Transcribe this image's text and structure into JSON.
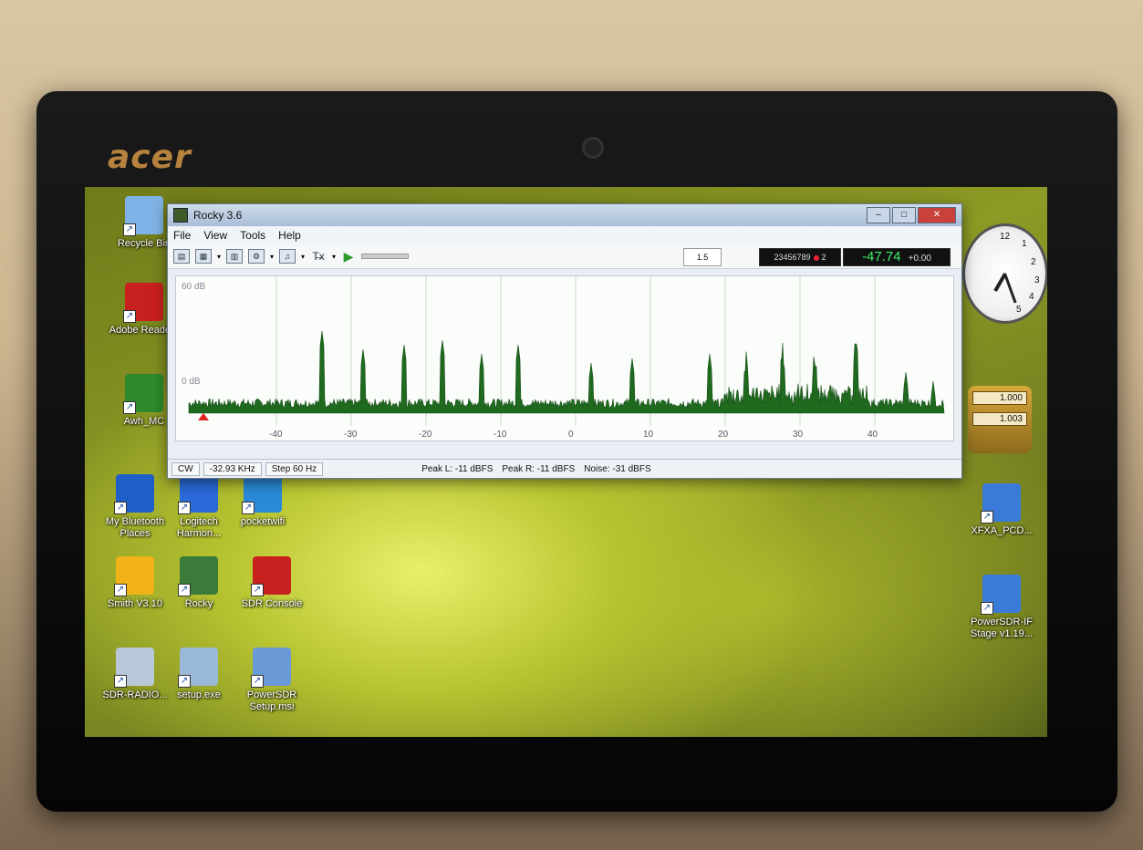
{
  "laptop": {
    "brand": "acer"
  },
  "desktop_icons": [
    {
      "id": "recycle-bin",
      "label": "Recycle Bin",
      "icon": "recycle-bin-icon",
      "color": "#7fb2e6"
    },
    {
      "id": "adobe-reader",
      "label": "Adobe Reade 9",
      "icon": "adobe-reader-icon",
      "color": "#c8201e"
    },
    {
      "id": "awh-mc",
      "label": "Awh_MC",
      "icon": "audio-meter-icon",
      "color": "#2c8a2c"
    },
    {
      "id": "my-bluetooth",
      "label": "My Bluetooth Places",
      "icon": "bluetooth-icon",
      "color": "#1f5fc7"
    },
    {
      "id": "logitech-harmony",
      "label": "Logitech Harmon...",
      "icon": "harmony-icon",
      "color": "#2a6ad8"
    },
    {
      "id": "pocketwifi",
      "label": "pocketwifi",
      "icon": "pocketwifi-icon",
      "color": "#2a8ad8"
    },
    {
      "id": "smith",
      "label": "Smith V3.10",
      "icon": "smith-chart-icon",
      "color": "#f2b21a"
    },
    {
      "id": "rocky",
      "label": "Rocky",
      "icon": "circuit-board-icon",
      "color": "#3a7a3a"
    },
    {
      "id": "sdr-console",
      "label": "SDR Console",
      "icon": "sdr-console-icon",
      "color": "#c8201e"
    },
    {
      "id": "sdr-radio",
      "label": "SDR-RADIO...",
      "icon": "installer-icon",
      "color": "#b8c8d8"
    },
    {
      "id": "setup-exe",
      "label": "setup.exe",
      "icon": "setup-cd-icon",
      "color": "#9ab8d8"
    },
    {
      "id": "powersdr-setup",
      "label": "PowerSDR Setup.msi",
      "icon": "msi-installer-icon",
      "color": "#6a9ad8"
    },
    {
      "id": "xfxa-pcd",
      "label": "XFXA_PCD...",
      "icon": "installer-icon",
      "color": "#3a7ad8"
    },
    {
      "id": "powersdr-if",
      "label": "PowerSDR-IF Stage v1.19...",
      "icon": "installer-icon",
      "color": "#3a7ad8"
    }
  ],
  "window": {
    "title": "Rocky 3.6",
    "menu": [
      "File",
      "View",
      "Tools",
      "Help"
    ],
    "readouts": {
      "box1": "1.5",
      "frequency_digits": "23456789",
      "frequency_small": "2",
      "level": "-47.74",
      "offset": "+0.00"
    },
    "spectrum": {
      "top_label": "60 dB",
      "zero_label": "0 dB",
      "x_ticks": [
        "-40",
        "-30",
        "-20",
        "-10",
        "0",
        "10",
        "20",
        "30",
        "40"
      ]
    },
    "status": {
      "mode": "CW",
      "offset_freq": "-32.93 KHz",
      "step": "Step 60 Hz",
      "peak_l": "Peak L: -11 dBFS",
      "peak_r": "Peak R: -11 dBFS",
      "noise": "Noise: -31 dBFS"
    }
  },
  "gadget": {
    "values": [
      "1.000",
      "1.003"
    ]
  },
  "clock": {
    "numbers": [
      "12",
      "1",
      "2",
      "3",
      "4",
      "5"
    ]
  }
}
